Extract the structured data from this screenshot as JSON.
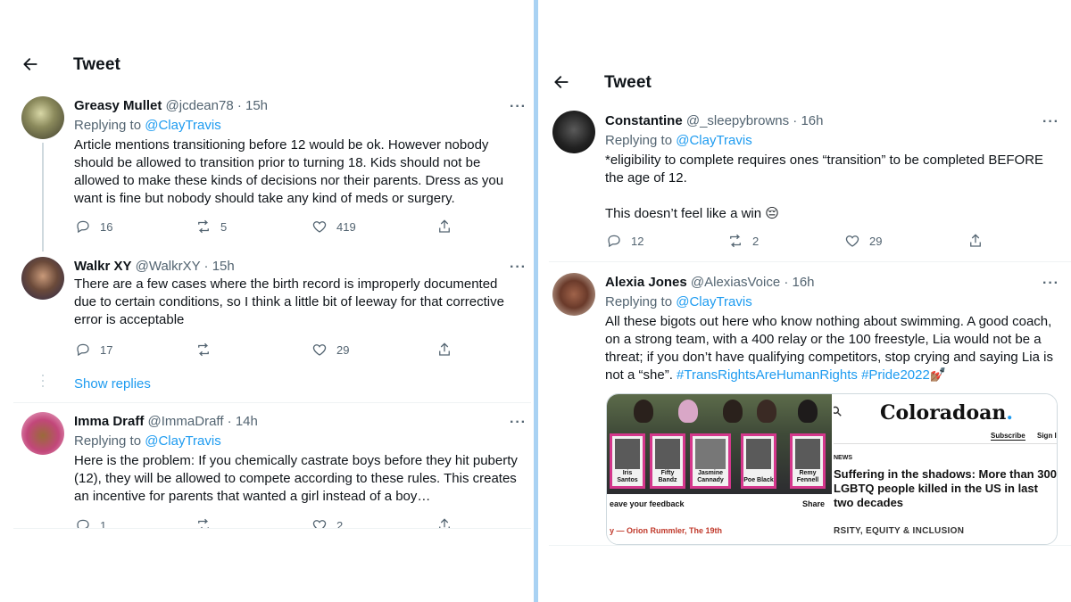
{
  "left": {
    "header_title": "Tweet",
    "tweets": [
      {
        "name": "Greasy Mullet",
        "handle": "@jcdean78 · 15h",
        "replying_prefix": "Replying to ",
        "replying_to": "@ClayTravis",
        "text": "Article mentions transitioning before 12 would be ok. However nobody should be allowed to transition prior to turning 18. Kids should not be allowed to make these kinds of decisions nor their parents. Dress as you want is fine but nobody should take any kind of meds or surgery.",
        "replies": "16",
        "retweets": "5",
        "likes": "419"
      },
      {
        "name": "Walkr XY",
        "handle": "@WalkrXY · 15h",
        "text": "There are a few cases where the birth record is improperly documented due to certain conditions, so I think a little bit of leeway for that corrective error is acceptable",
        "replies": "17",
        "retweets": "",
        "likes": "29"
      },
      {
        "name": "Imma Draff",
        "handle": "@ImmaDraff · 14h",
        "replying_prefix": "Replying to ",
        "replying_to": "@ClayTravis",
        "text": "Here is the problem: If you chemically castrate boys before they hit puberty (12), they will be allowed to compete according to these rules.  This creates an incentive for parents that wanted a girl instead of a boy…",
        "replies": "1",
        "retweets": "",
        "likes": "2"
      }
    ],
    "show_replies": "Show replies"
  },
  "right": {
    "header_title": "Tweet",
    "tweets": [
      {
        "name": "Constantine",
        "handle": "@_sleepybrowns · 16h",
        "replying_prefix": "Replying to ",
        "replying_to": "@ClayTravis",
        "text": "*eligibility to complete requires ones “transition” to be completed BEFORE the age of 12.",
        "text2": "This doesn’t feel like a win 😔",
        "replies": "12",
        "retweets": "2",
        "likes": "29"
      },
      {
        "name": "Alexia Jones",
        "handle": "@AlexiasVoice · 16h",
        "replying_prefix": "Replying to ",
        "replying_to": "@ClayTravis",
        "text": "All these bigots out here who know nothing about swimming. A good coach, on a strong team, with a 400 relay or the 100 freestyle, Lia would not be a threat; if you don’t have qualifying competitors, stop crying and saying Lia is not a “she”. ",
        "hashtag1": "#TransRightsAreHumanRights",
        "hashtag2": "#Pride2022",
        "hashtag_emoji": "💅🏽",
        "card": {
          "signs": [
            "Iris Santos",
            "Fifty Bandz",
            "Jasmine Cannady",
            "Poe Black",
            "Remy Fennell"
          ],
          "feedback": "eave your feedback",
          "share": "Share",
          "left_footer": "y — Orion Rummler, The 19th",
          "brand": "Coloradoan",
          "brand_dot": ".",
          "subscribe": "Subscribe",
          "signin": "Sign I",
          "section": "NEWS",
          "headline": "Suffering in the shadows: More than 300 LGBTQ people killed in the US in last two decades",
          "footer": "RSITY, EQUITY & INCLUSION"
        }
      }
    ]
  },
  "colors": {
    "accent": "#1d9bf0",
    "divider": "#a9d2f3",
    "secondary_text": "#536471"
  }
}
